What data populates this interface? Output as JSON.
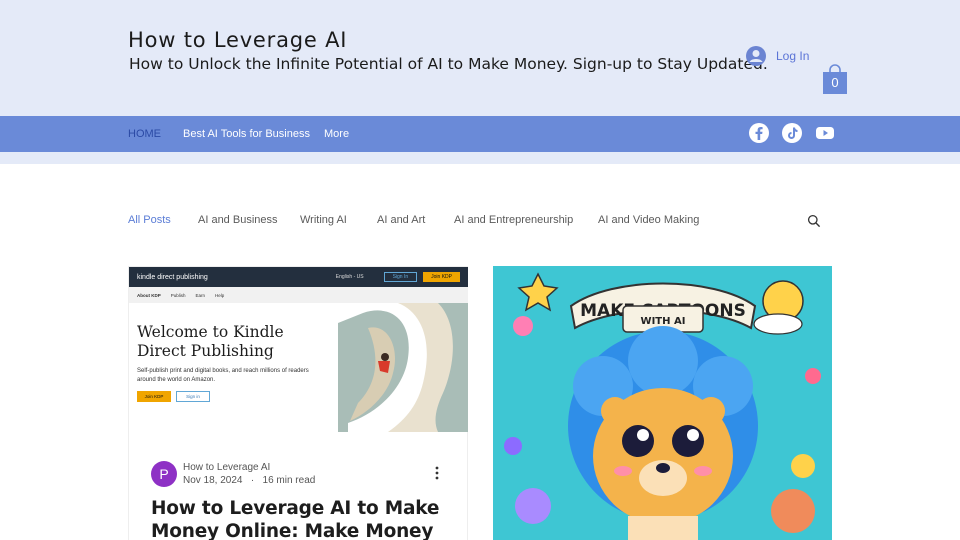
{
  "header": {
    "title": "How to Leverage AI",
    "subtitle": "How to Unlock the Infinite Potential of AI to Make Money. Sign-up to Stay Updated.",
    "login_label": "Log In",
    "cart_count": "0"
  },
  "nav": {
    "items": [
      "HOME",
      "Best AI Tools for Business",
      "More"
    ],
    "social": [
      "facebook-icon",
      "tiktok-icon",
      "youtube-icon"
    ]
  },
  "categories": [
    "All Posts",
    "AI and Business",
    "Writing AI",
    "AI and Art",
    "AI and Entrepreneurship",
    "AI and Video Making"
  ],
  "posts": [
    {
      "image": {
        "logo": "kindle direct publishing",
        "lang": "English - US",
        "sign_in": "Sign In",
        "join": "Join KDP",
        "tabs": [
          "About KDP",
          "Publish",
          "Earn",
          "Help"
        ],
        "heading": "Welcome to Kindle Direct Publishing",
        "text": "Self-publish print and digital books, and reach millions of readers around the world on Amazon.",
        "btn_join": "Join KDP",
        "btn_sign": "Sign in"
      },
      "author_initial": "P",
      "author": "How to Leverage AI",
      "date": "Nov 18, 2024",
      "read_time": "16 min read",
      "title": "How to Leverage AI to Make Money Online: Make Money"
    },
    {
      "image": {
        "banner_line1": "MAKE CARTOONS",
        "banner_line2": "WITH AI"
      }
    }
  ],
  "colors": {
    "header_bg": "#e4eaf8",
    "nav_bg": "#6a8ad8",
    "accent": "#5b7dd6"
  }
}
